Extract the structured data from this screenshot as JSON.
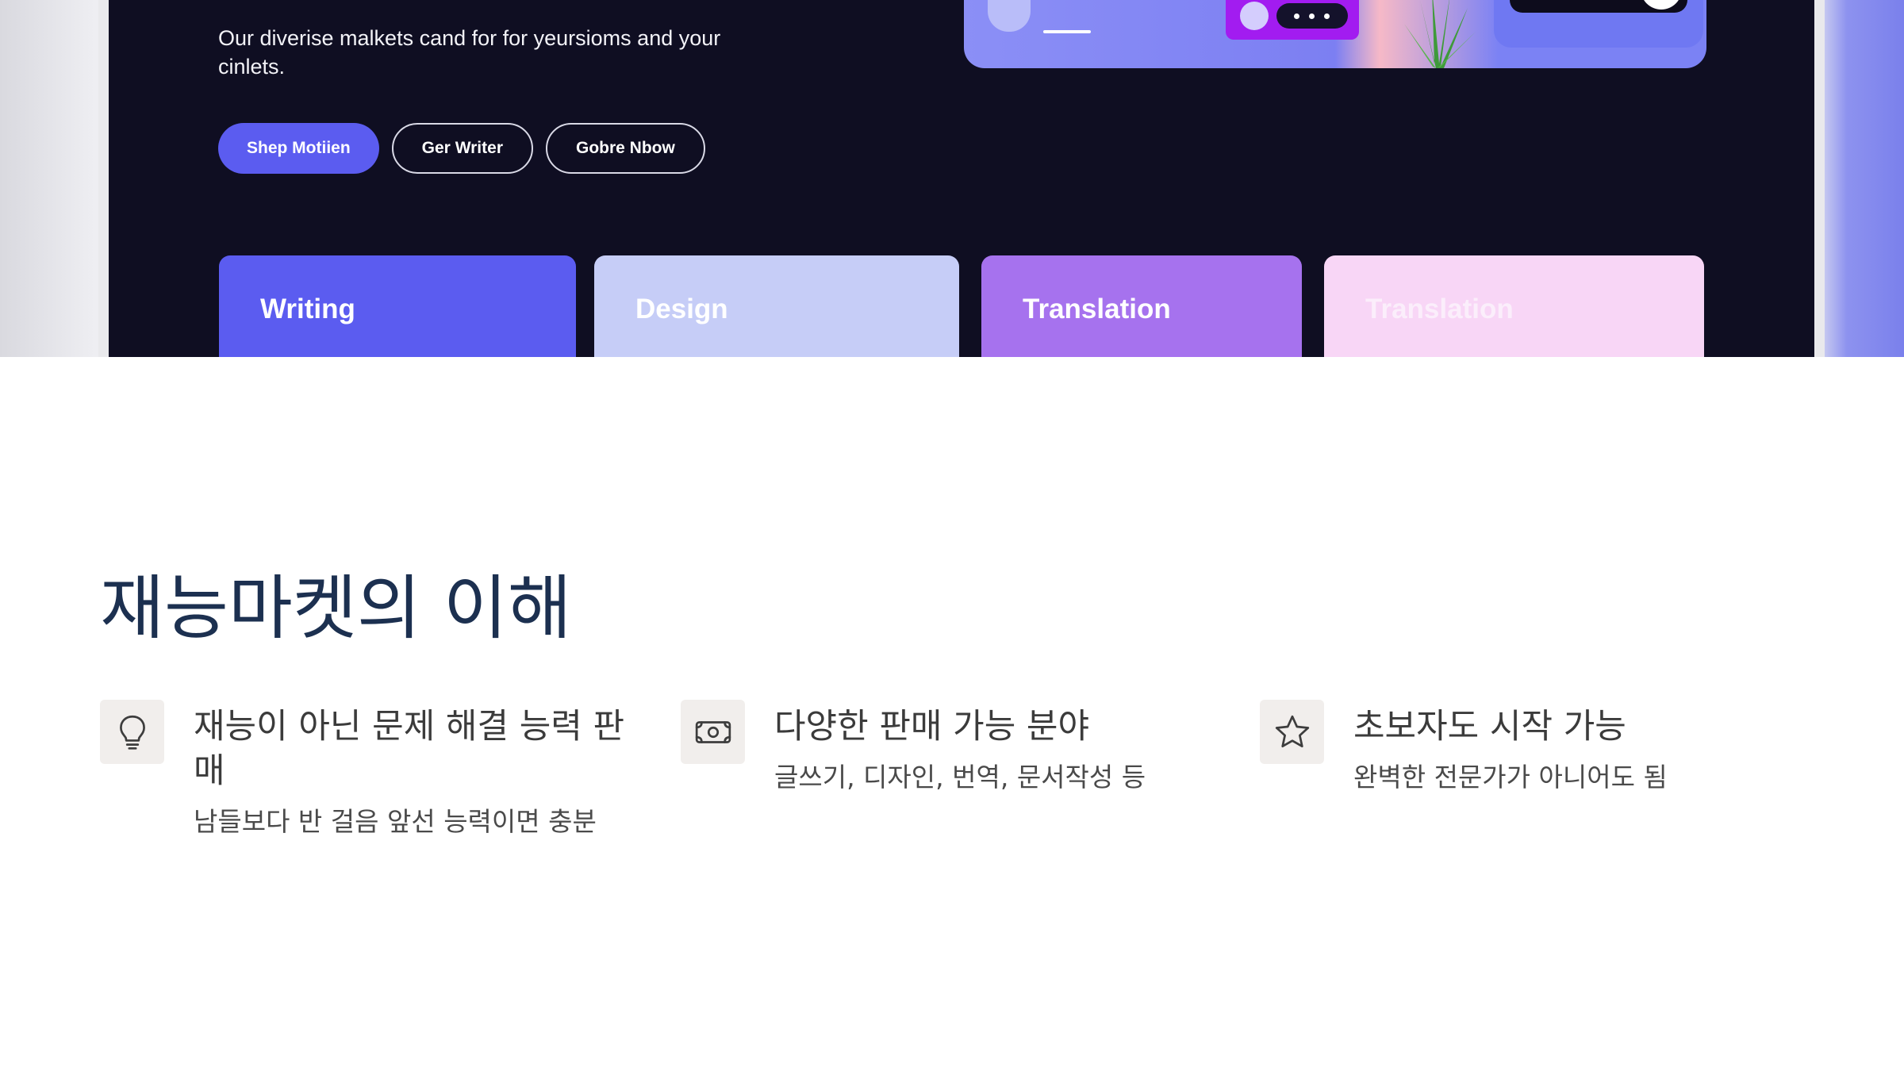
{
  "hero": {
    "description": "Our diverise malkets cand for for yeursioms and your cinlets.",
    "buttons": [
      "Shep Motiien",
      "Ger Writer",
      "Gobre Nbow"
    ],
    "categories": [
      {
        "label": "Writing",
        "bg": "#5b5cf0",
        "color": "#ffffff"
      },
      {
        "label": "Design",
        "bg": "#c6cdf7",
        "color": "#ffffff"
      },
      {
        "label": "Translation",
        "bg": "#a672ee",
        "color": "#ffffff"
      },
      {
        "label": "Translation",
        "bg": "#f8d6f6",
        "color": "#fbeefb"
      }
    ]
  },
  "section": {
    "title": "재능마켓의 이해",
    "features": [
      {
        "icon": "lightbulb-icon",
        "title": "재능이 아닌 문제 해결 능력 판매",
        "desc": "남들보다 반 걸음 앞선 능력이면 충분"
      },
      {
        "icon": "money-icon",
        "title": "다양한 판매 가능 분야",
        "desc": "글쓰기, 디자인, 번역, 문서작성 등"
      },
      {
        "icon": "star-icon",
        "title": "초보자도 시작 가능",
        "desc": "완벽한 전문가가 아니어도 됨"
      }
    ]
  },
  "colors": {
    "title": "#1c3050",
    "icon_bg": "#f1eeec",
    "hero_bg": "#0f0e22",
    "accent": "#5b5cf0"
  }
}
